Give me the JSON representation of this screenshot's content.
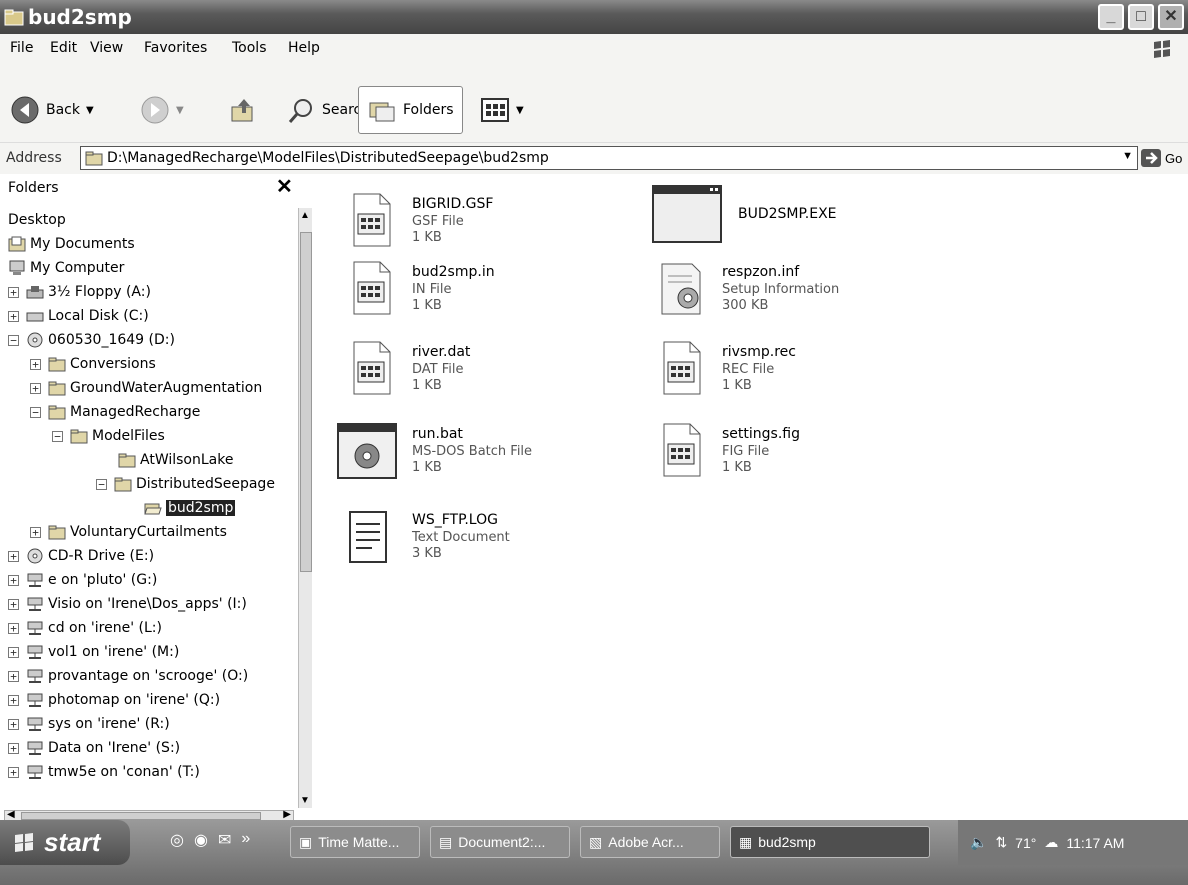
{
  "window": {
    "title": "bud2smp",
    "min_glyph": "_",
    "max_glyph": "□",
    "close_glyph": "✕"
  },
  "menu": [
    "File",
    "Edit",
    "View",
    "Favorites",
    "Tools",
    "Help"
  ],
  "toolbar": {
    "back_label": "Back",
    "search_label": "Search",
    "folders_label": "Folders"
  },
  "address": {
    "label": "Address",
    "path": "D:\\ManagedRecharge\\ModelFiles\\DistributedSeepage\\bud2smp",
    "go_label": "Go"
  },
  "folders_pane": {
    "title": "Folders",
    "close_glyph": "✕",
    "items": [
      {
        "label": "Desktop",
        "expander": ""
      },
      {
        "label": "My Documents",
        "expander": ""
      },
      {
        "label": "My Computer",
        "expander": ""
      },
      {
        "label": "3½ Floppy (A:)",
        "expander": "+"
      },
      {
        "label": "Local Disk (C:)",
        "expander": "+"
      },
      {
        "label": "060530_1649 (D:)",
        "expander": "−"
      },
      {
        "label": "Conversions",
        "expander": "+"
      },
      {
        "label": "GroundWaterAugmentation",
        "expander": "+"
      },
      {
        "label": "ManagedRecharge",
        "expander": "−"
      },
      {
        "label": "ModelFiles",
        "expander": "−"
      },
      {
        "label": "AtWilsonLake",
        "expander": ""
      },
      {
        "label": "DistributedSeepage",
        "expander": "−"
      },
      {
        "label": "bud2smp",
        "expander": ""
      },
      {
        "label": "VoluntaryCurtailments",
        "expander": "+"
      },
      {
        "label": "CD-R Drive (E:)",
        "expander": "+"
      },
      {
        "label": "e on 'pluto' (G:)",
        "expander": "+"
      },
      {
        "label": "Visio on 'Irene\\Dos_apps' (I:)",
        "expander": "+"
      },
      {
        "label": "cd on 'irene' (L:)",
        "expander": "+"
      },
      {
        "label": "vol1 on 'irene' (M:)",
        "expander": "+"
      },
      {
        "label": "provantage on 'scrooge' (O:)",
        "expander": "+"
      },
      {
        "label": "photomap on 'irene' (Q:)",
        "expander": "+"
      },
      {
        "label": "sys on 'irene' (R:)",
        "expander": "+"
      },
      {
        "label": "Data on 'Irene' (S:)",
        "expander": "+"
      },
      {
        "label": "tmw5e on 'conan' (T:)",
        "expander": "+"
      }
    ]
  },
  "files": [
    {
      "name": "BIGRID.GSF",
      "type": "GSF File",
      "size": "1 KB",
      "icon": "generic-file-icon"
    },
    {
      "name": "BUD2SMP.EXE",
      "type": "",
      "size": "",
      "icon": "application-window-icon"
    },
    {
      "name": "bud2smp.in",
      "type": "IN File",
      "size": "1 KB",
      "icon": "generic-file-icon"
    },
    {
      "name": "respzon.inf",
      "type": "Setup Information",
      "size": "300 KB",
      "icon": "setup-info-icon"
    },
    {
      "name": "river.dat",
      "type": "DAT File",
      "size": "1 KB",
      "icon": "generic-file-icon"
    },
    {
      "name": "rivsmp.rec",
      "type": "REC File",
      "size": "1 KB",
      "icon": "generic-file-icon"
    },
    {
      "name": "run.bat",
      "type": "MS-DOS Batch File",
      "size": "1 KB",
      "icon": "batch-file-icon"
    },
    {
      "name": "settings.fig",
      "type": "FIG File",
      "size": "1 KB",
      "icon": "generic-file-icon"
    },
    {
      "name": "WS_FTP.LOG",
      "type": "Text Document",
      "size": "3 KB",
      "icon": "text-document-icon"
    }
  ],
  "taskbar": {
    "start_label": "start",
    "tasks": [
      "Time Matte...",
      "Document2:...",
      "Adobe Acr...",
      "bud2smp"
    ],
    "temperature": "71°",
    "clock": "11:17 AM"
  }
}
